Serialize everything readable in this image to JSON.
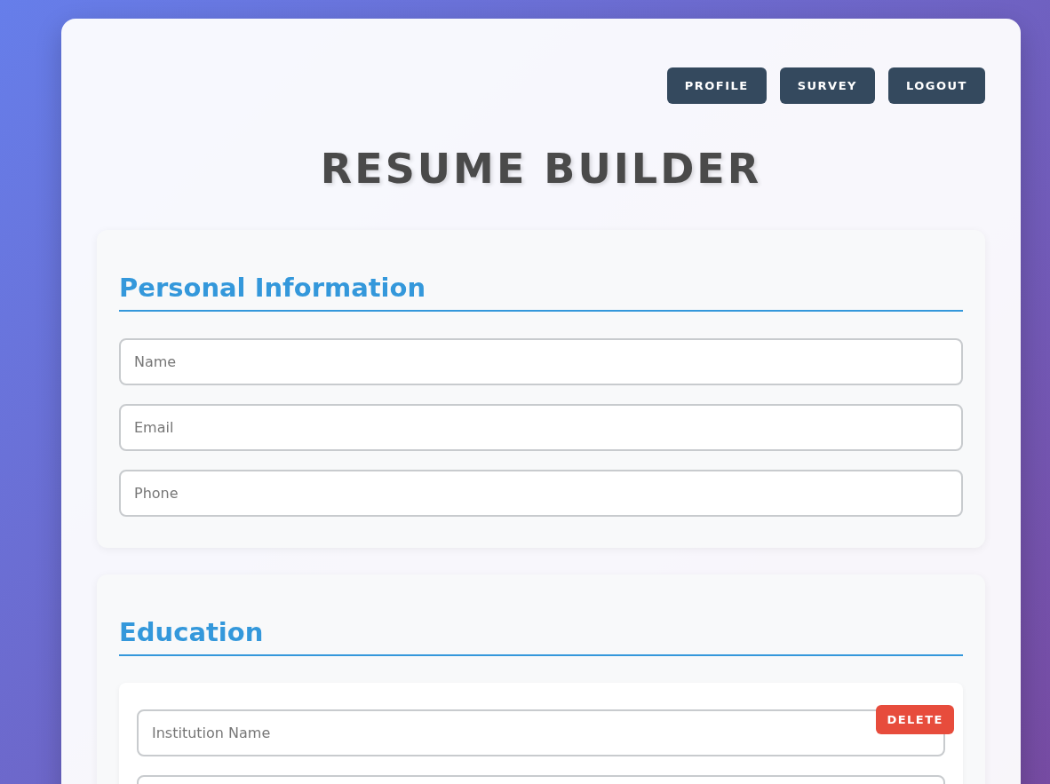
{
  "nav": {
    "buttons": [
      "PROFILE",
      "SURVEY",
      "LOGOUT"
    ]
  },
  "title": "RESUME BUILDER",
  "sections": [
    {
      "heading": "Personal Information",
      "fields": [
        {
          "kind": "text",
          "placeholder": "Name"
        },
        {
          "kind": "text",
          "placeholder": "Email"
        },
        {
          "kind": "text",
          "placeholder": "Phone"
        }
      ]
    },
    {
      "heading": "Education",
      "entries": [
        {
          "delete_label": "DELETE",
          "fields": [
            {
              "kind": "text",
              "placeholder": "Institution Name"
            },
            {
              "kind": "text"
            }
          ]
        }
      ]
    }
  ]
}
